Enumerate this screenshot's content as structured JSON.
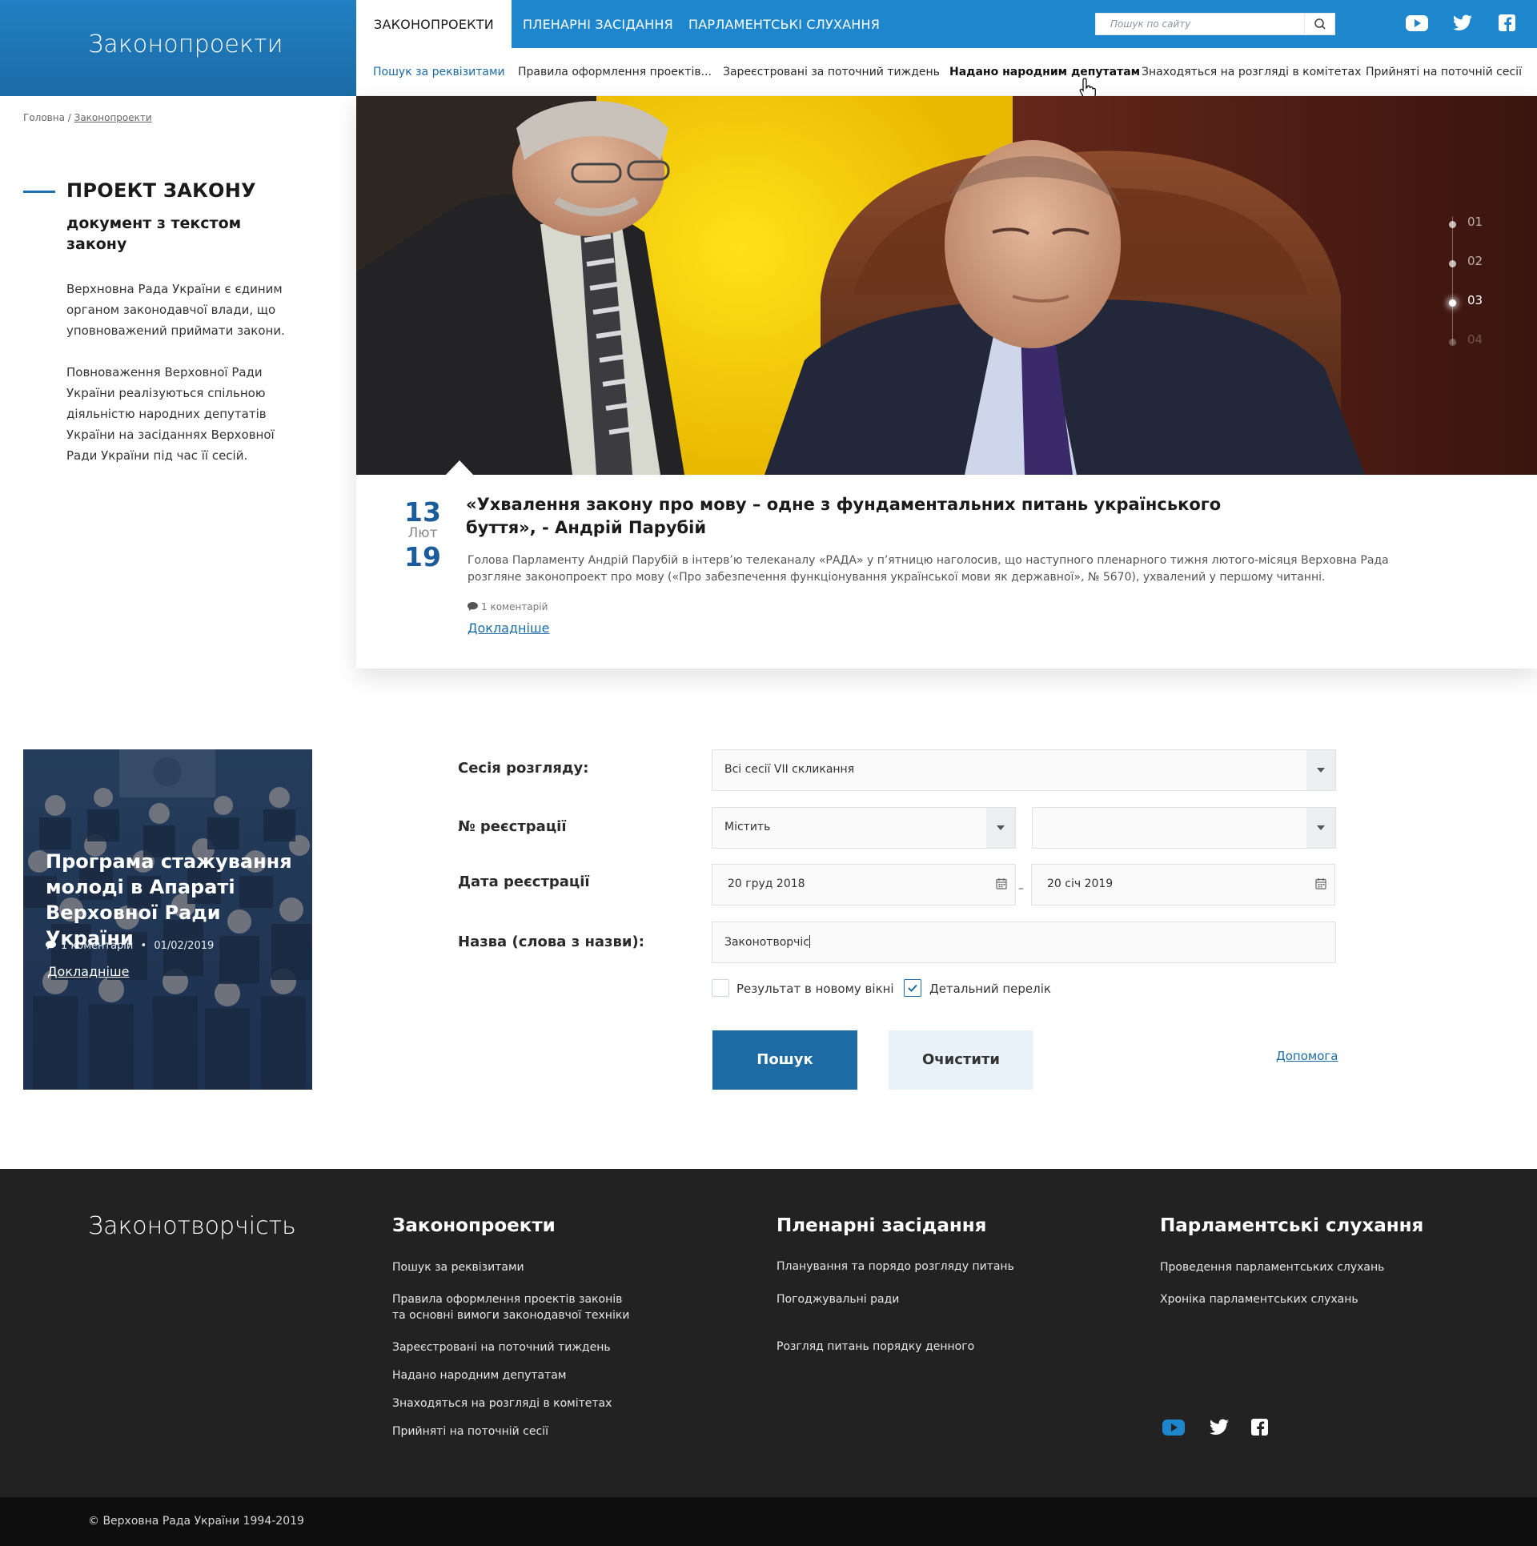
{
  "header": {
    "brand": "Законопроекти",
    "tabs": [
      {
        "label": "ЗАКОНОПРОЕКТИ"
      },
      {
        "label": "ПЛЕНАРНІ ЗАСІДАННЯ"
      },
      {
        "label": "ПАРЛАМЕНТСЬКІ СЛУХАННЯ"
      }
    ],
    "search_placeholder": "Пошук по сайту",
    "subnav": [
      {
        "label": "Пошук за реквізитами"
      },
      {
        "label": "Правила оформлення проектів..."
      },
      {
        "label": "Зареєстровані за поточний тиждень"
      },
      {
        "label": "Надано народним депутатам"
      },
      {
        "label": "Знаходяться на розгляді в комітетах"
      },
      {
        "label": "Прийняті на поточній сесії"
      }
    ],
    "social_icons": [
      "youtube-icon",
      "twitter-icon",
      "facebook-icon"
    ]
  },
  "breadcrumb": {
    "home": "Головна",
    "separator": " / ",
    "current": "Законопроекти"
  },
  "section": {
    "title": "ПРОЕКТ ЗАКОНУ",
    "subtitle": "документ з текстом закону",
    "paragraphs": [
      "Верхновна Рада України є єдиним органом законодавчої влади, що уповноважений приймати закони.",
      "Повноваження Верховної Ради України реалізуються спільною діяльністю народних депутатів України на засіданнях Верховної Ради України під час її сесій."
    ]
  },
  "slider": {
    "numbers": [
      "01",
      "02",
      "03",
      "04"
    ],
    "active_index": 2
  },
  "news": {
    "day": "13",
    "month": "Лют",
    "year": "19",
    "title": "«Ухвалення закону про мову – одне з фундаментальних питань українського буття», - Андрій Парубій",
    "text": "Голова Парламенту Андрій Парубій в інтерв’ю телеканалу «РАДА» у п’ятницю наголосив, що наступного пленарного тижня лютого-місяця Верховна Рада розгляне законопроект про мову («Про забезпечення функціонування української мови як державної», № 5670), ухвалений у першому читанні.",
    "comments": "1 коментарій",
    "more": "Докладніше"
  },
  "promo": {
    "title": "Програма стажування молоді в Апараті Верховної Ради України",
    "comments": "1 коментарій",
    "bullet": "•",
    "date": "01/02/2019",
    "more": "Докладніше"
  },
  "form": {
    "session_label": "Сесія розгляду:",
    "session_value": "Всі сесії VII скликання",
    "reg_label": "№ реєстрації",
    "reg_mode": "Містить",
    "reg_value": "",
    "date_label": "Дата реєстрації",
    "date_from": "20 груд 2018",
    "date_sep": "–",
    "date_to": "20 січ 2019",
    "name_label": "Назва (слова з назви):",
    "name_value": "Законотворчіс",
    "check_new_window": "Результат в новому вікні",
    "check_new_window_checked": false,
    "check_detailed": "Детальний перелік",
    "check_detailed_checked": true,
    "search_button": "Пошук",
    "clear_button": "Очистити",
    "help_link": "Допомога"
  },
  "footer": {
    "brand": "Законотворчість",
    "columns": [
      {
        "title": "Законопроекти",
        "links": [
          "Пошук за реквізитами",
          "Правила оформлення проектів законів",
          "та основні вимоги законодавчої техніки",
          "Зареєстровані на поточний тиждень",
          "Надано народним депутатам",
          "Знаходяться на розгляді в комітетах",
          "Прийняті на поточній сесії"
        ]
      },
      {
        "title": "Пленарні засідання",
        "links": [
          "Планування та порядо розгляду питань",
          "Погоджувальні ради",
          "Розгляд питань порядку денного"
        ]
      },
      {
        "title": "Парламентські слухання",
        "links": [
          "Проведення парламентських слухань",
          "Хроніка парламентських слухань"
        ]
      }
    ],
    "copyright": "© Верховна Рада України 1994-2019"
  },
  "colors": {
    "brand_blue": "#1e86cc",
    "dark_blue": "#1d6aa4",
    "footer_bg": "#222222"
  }
}
